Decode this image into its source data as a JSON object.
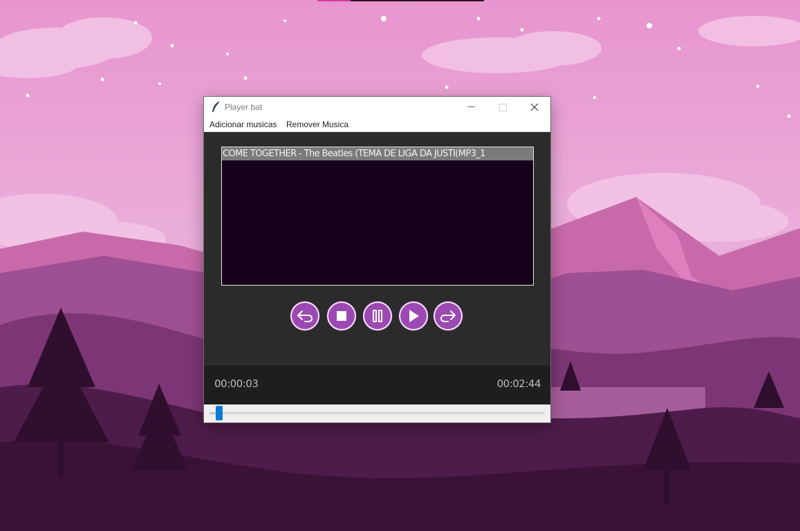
{
  "window": {
    "title": "Player bat"
  },
  "menubar": {
    "items": [
      {
        "label": "Adicionar musicas"
      },
      {
        "label": "Remover Musica"
      }
    ]
  },
  "playlist": {
    "items": [
      {
        "title": "COME TOGETHER - The Beatles (TEMA DE LIGA DA JUSTI(MP3_1",
        "selected": true
      }
    ]
  },
  "controls": {
    "buttons": [
      {
        "icon": "previous-arrow-icon"
      },
      {
        "icon": "stop-icon"
      },
      {
        "icon": "pause-icon"
      },
      {
        "icon": "play-icon"
      },
      {
        "icon": "next-arrow-icon"
      }
    ],
    "color": "#9c49b3"
  },
  "playback": {
    "elapsed": "00:00:03",
    "total": "00:02:44",
    "progress_fraction": 0.018
  },
  "colors": {
    "accent": "#9c49b3",
    "seek_thumb": "#0a7ad4",
    "playlist_bg": "#16001a",
    "selection": "#7a7a7a"
  }
}
